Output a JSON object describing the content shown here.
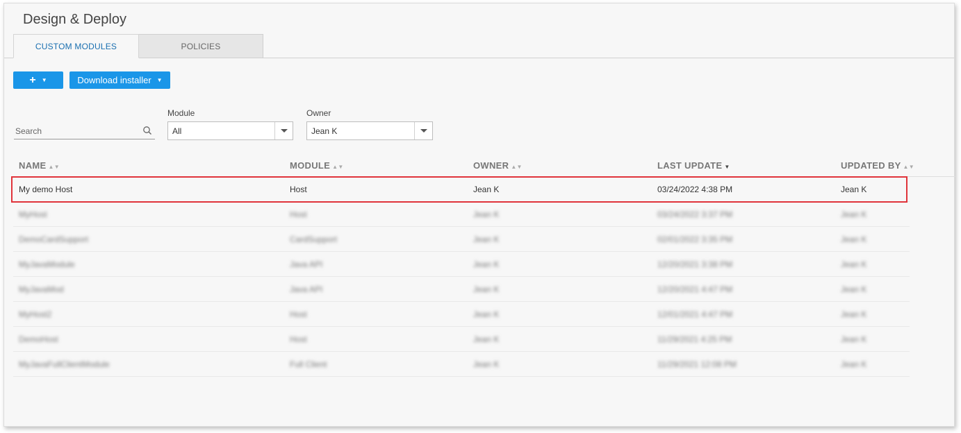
{
  "page": {
    "title": "Design & Deploy"
  },
  "tabs": [
    {
      "label": "CUSTOM MODULES"
    },
    {
      "label": "POLICIES"
    }
  ],
  "toolbar": {
    "add_label": "+",
    "download_label": "Download installer"
  },
  "filters": {
    "search_placeholder": "Search",
    "module_label": "Module",
    "module_value": "All",
    "owner_label": "Owner",
    "owner_value": "Jean K"
  },
  "table": {
    "columns": [
      "NAME",
      "MODULE",
      "OWNER",
      "LAST UPDATE",
      "UPDATED BY"
    ],
    "sorted_column": "LAST UPDATE",
    "rows": [
      {
        "name": "My demo Host",
        "module": "Host",
        "owner": "Jean K",
        "last_update": "03/24/2022 4:38 PM",
        "updated_by": "Jean K"
      },
      {
        "name": "MyHost",
        "module": "Host",
        "owner": "Jean K",
        "last_update": "03/24/2022 3:37 PM",
        "updated_by": "Jean K"
      },
      {
        "name": "DemoCardSupport",
        "module": "CardSupport",
        "owner": "Jean K",
        "last_update": "02/01/2022 3:35 PM",
        "updated_by": "Jean K"
      },
      {
        "name": "MyJavaModule",
        "module": "Java API",
        "owner": "Jean K",
        "last_update": "12/20/2021 3:38 PM",
        "updated_by": "Jean K"
      },
      {
        "name": "MyJavaMod",
        "module": "Java API",
        "owner": "Jean K",
        "last_update": "12/20/2021 4:47 PM",
        "updated_by": "Jean K"
      },
      {
        "name": "MyHost2",
        "module": "Host",
        "owner": "Jean K",
        "last_update": "12/01/2021 4:47 PM",
        "updated_by": "Jean K"
      },
      {
        "name": "DemoHost",
        "module": "Host",
        "owner": "Jean K",
        "last_update": "11/29/2021 4:25 PM",
        "updated_by": "Jean K"
      },
      {
        "name": "MyJavaFullClientModule",
        "module": "Full Client",
        "owner": "Jean K",
        "last_update": "11/29/2021 12:08 PM",
        "updated_by": "Jean K"
      }
    ]
  },
  "colors": {
    "accent": "#1a96e8",
    "highlight": "#e0333a",
    "tab_active_text": "#1a6fb0"
  }
}
